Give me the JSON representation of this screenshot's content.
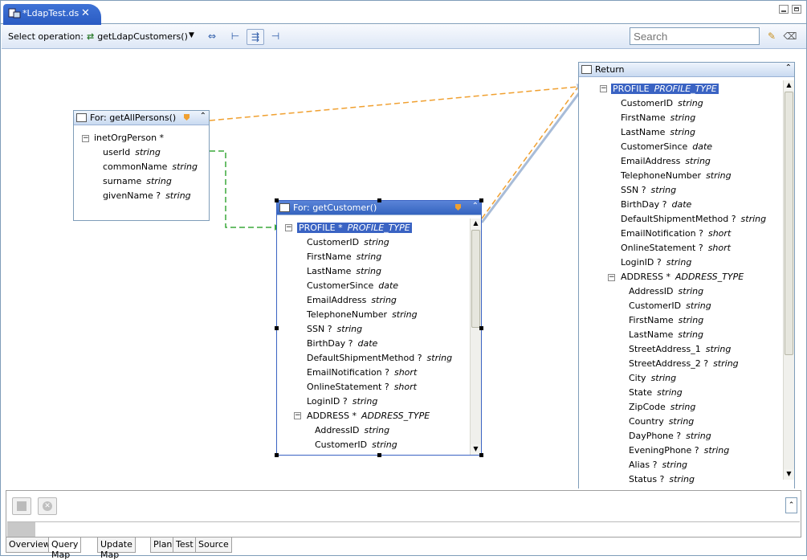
{
  "editor_tab": {
    "title": "*LdapTest.ds"
  },
  "toolbar": {
    "select_label": "Select operation:",
    "operation": "getLdapCustomers()",
    "search_placeholder": "Search"
  },
  "for_persons": {
    "title": "For: getAllPersons()",
    "root": "inetOrgPerson *",
    "fields": [
      {
        "name": "userId",
        "type": "string"
      },
      {
        "name": "commonName",
        "type": "string"
      },
      {
        "name": "surname",
        "type": "string"
      },
      {
        "name": "givenName ?",
        "type": "string"
      }
    ]
  },
  "for_customer": {
    "title": "For: getCustomer()",
    "root": {
      "name": "PROFILE *",
      "type": "PROFILE_TYPE"
    },
    "fields": [
      {
        "name": "CustomerID",
        "type": "string"
      },
      {
        "name": "FirstName",
        "type": "string"
      },
      {
        "name": "LastName",
        "type": "string"
      },
      {
        "name": "CustomerSince",
        "type": "date"
      },
      {
        "name": "EmailAddress",
        "type": "string"
      },
      {
        "name": "TelephoneNumber",
        "type": "string"
      },
      {
        "name": "SSN ?",
        "type": "string"
      },
      {
        "name": "BirthDay ?",
        "type": "date"
      },
      {
        "name": "DefaultShipmentMethod ?",
        "type": "string"
      },
      {
        "name": "EmailNotification ?",
        "type": "short"
      },
      {
        "name": "OnlineStatement ?",
        "type": "short"
      },
      {
        "name": "LoginID ?",
        "type": "string"
      }
    ],
    "address": {
      "name": "ADDRESS *",
      "type": "ADDRESS_TYPE"
    },
    "address_fields": [
      {
        "name": "AddressID",
        "type": "string"
      },
      {
        "name": "CustomerID",
        "type": "string"
      }
    ]
  },
  "return_box": {
    "title": "Return",
    "root": {
      "name": "PROFILE",
      "type": "PROFILE_TYPE"
    },
    "fields": [
      {
        "name": "CustomerID",
        "type": "string"
      },
      {
        "name": "FirstName",
        "type": "string"
      },
      {
        "name": "LastName",
        "type": "string"
      },
      {
        "name": "CustomerSince",
        "type": "date"
      },
      {
        "name": "EmailAddress",
        "type": "string"
      },
      {
        "name": "TelephoneNumber",
        "type": "string"
      },
      {
        "name": "SSN ?",
        "type": "string"
      },
      {
        "name": "BirthDay ?",
        "type": "date"
      },
      {
        "name": "DefaultShipmentMethod ?",
        "type": "string"
      },
      {
        "name": "EmailNotification ?",
        "type": "short"
      },
      {
        "name": "OnlineStatement ?",
        "type": "short"
      },
      {
        "name": "LoginID ?",
        "type": "string"
      }
    ],
    "address": {
      "name": "ADDRESS *",
      "type": "ADDRESS_TYPE"
    },
    "address_fields": [
      {
        "name": "AddressID",
        "type": "string"
      },
      {
        "name": "CustomerID",
        "type": "string"
      },
      {
        "name": "FirstName",
        "type": "string"
      },
      {
        "name": "LastName",
        "type": "string"
      },
      {
        "name": "StreetAddress_1",
        "type": "string"
      },
      {
        "name": "StreetAddress_2 ?",
        "type": "string"
      },
      {
        "name": "City",
        "type": "string"
      },
      {
        "name": "State",
        "type": "string"
      },
      {
        "name": "ZipCode",
        "type": "string"
      },
      {
        "name": "Country",
        "type": "string"
      },
      {
        "name": "DayPhone ?",
        "type": "string"
      },
      {
        "name": "EveningPhone ?",
        "type": "string"
      },
      {
        "name": "Alias ?",
        "type": "string"
      },
      {
        "name": "Status ?",
        "type": "string"
      }
    ]
  },
  "bottom_tabs": [
    "Overview",
    "Query Map",
    "Update Map",
    "Plan",
    "Test",
    "Source"
  ],
  "colors": {
    "accent": "#3a63c3",
    "mapping_green": "#3aa83a",
    "mapping_orange": "#f0a030",
    "mapping_blue": "#a8bcd8"
  }
}
